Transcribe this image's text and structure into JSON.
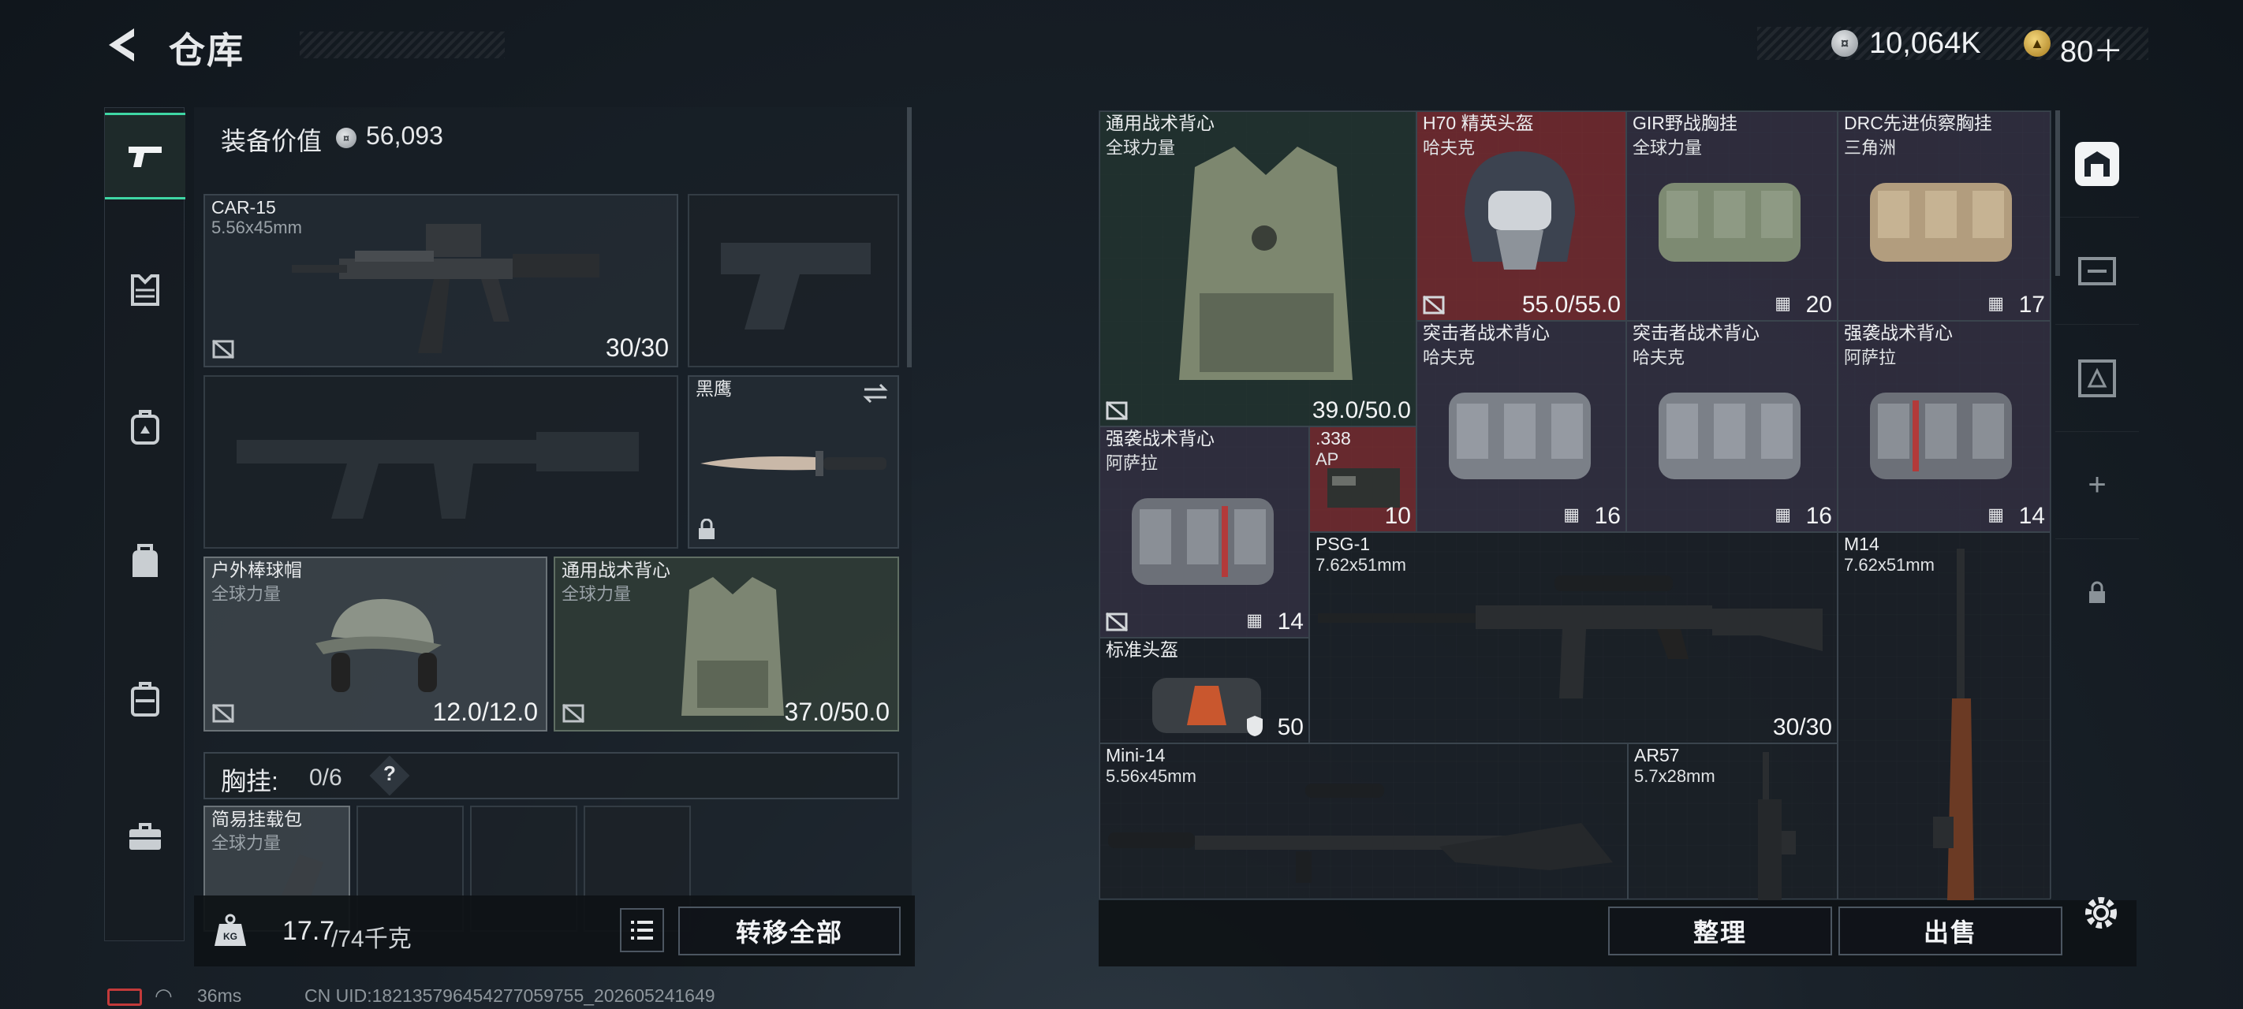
{
  "header": {
    "title": "仓库",
    "currency_silver": "10,064K",
    "currency_gold": "80＋"
  },
  "left_nav": [
    "pistol-icon",
    "armor-icon",
    "backpack-icon",
    "bag-icon",
    "luggage-icon",
    "toolbox-icon"
  ],
  "equipment": {
    "value_label": "装备价值",
    "value": "56,093",
    "primary": {
      "name": "CAR-15",
      "sub": "5.56x45mm",
      "value": "30/30"
    },
    "knife": {
      "name": "黑鹰"
    },
    "helmet": {
      "name": "户外棒球帽",
      "sub": "全球力量",
      "value": "12.0/12.0"
    },
    "vest": {
      "name": "通用战术背心",
      "sub": "全球力量",
      "value": "37.0/50.0"
    },
    "chest_rig_label": "胸挂:",
    "chest_rig_count": "0/6",
    "chest_rig_help": "?",
    "rig_item": {
      "name": "简易挂载包",
      "sub": "全球力量"
    }
  },
  "footer": {
    "weight_icon": "KG",
    "weight_current": "17.7",
    "weight_max": "/74千克",
    "transfer_all": "转移全部",
    "organize": "整理",
    "sell": "出售"
  },
  "stash": {
    "items": [
      {
        "name": "通用战术背心",
        "sub": "全球力量",
        "value": "39.0/50.0"
      },
      {
        "name": "H70 精英头盔",
        "sub": "哈夫克",
        "value": "55.0/55.0"
      },
      {
        "name": "GIR野战胸挂",
        "sub": "全球力量",
        "value": "20"
      },
      {
        "name": "DRC先进侦察胸挂",
        "sub": "三角洲",
        "value": "17"
      },
      {
        "name": "突击者战术背心",
        "sub": "哈夫克",
        "value": "16"
      },
      {
        "name": "突击者战术背心",
        "sub": "哈夫克",
        "value": "16"
      },
      {
        "name": "强袭战术背心",
        "sub": "阿萨拉",
        "value": "14"
      },
      {
        "name": "强袭战术背心",
        "sub": "阿萨拉",
        "value": "14"
      },
      {
        "name": ".338",
        "sub": "AP",
        "value": "10"
      },
      {
        "name": "PSG-1",
        "sub": "7.62x51mm",
        "value": "30/30"
      },
      {
        "name": "M14",
        "sub": "7.62x51mm",
        "value": ""
      },
      {
        "name": "标准头盔",
        "sub": "",
        "value": "50"
      },
      {
        "name": "Mini-14",
        "sub": "5.56x45mm",
        "value": ""
      },
      {
        "name": "AR57",
        "sub": "5.7x28mm",
        "value": ""
      }
    ]
  },
  "right_nav": {
    "add": "+"
  },
  "status_bar": {
    "ping": "36ms",
    "uid": "CN UID:182135796454277059755_202605241649"
  }
}
